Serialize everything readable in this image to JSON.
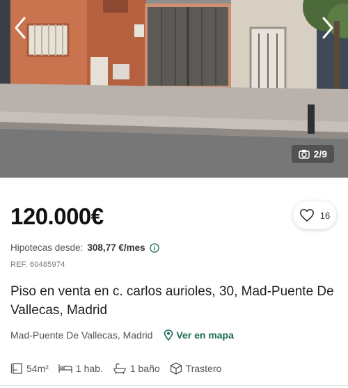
{
  "gallery": {
    "counter": "2/9",
    "prev_icon": "chevron-left-icon",
    "next_icon": "chevron-right-icon",
    "camera_icon": "camera-icon"
  },
  "listing": {
    "price": "120.000€",
    "favorites_count": "16",
    "mortgage_label": "Hipotecas desde:",
    "mortgage_value": "308,77 €/mes",
    "ref": "REF. 60485974",
    "title": "Piso en venta en c. carlos aurioles, 30, Mad-Puente De Vallecas, Madrid",
    "location": "Mad-Puente De Vallecas, Madrid",
    "map_link": "Ver en mapa"
  },
  "features": [
    {
      "icon": "area-icon",
      "label": "54m²"
    },
    {
      "icon": "bed-icon",
      "label": "1 hab."
    },
    {
      "icon": "bath-icon",
      "label": "1 baño"
    },
    {
      "icon": "storage-icon",
      "label": "Trastero"
    }
  ],
  "colors": {
    "accent": "#1b6b5a",
    "price": "#111111"
  }
}
